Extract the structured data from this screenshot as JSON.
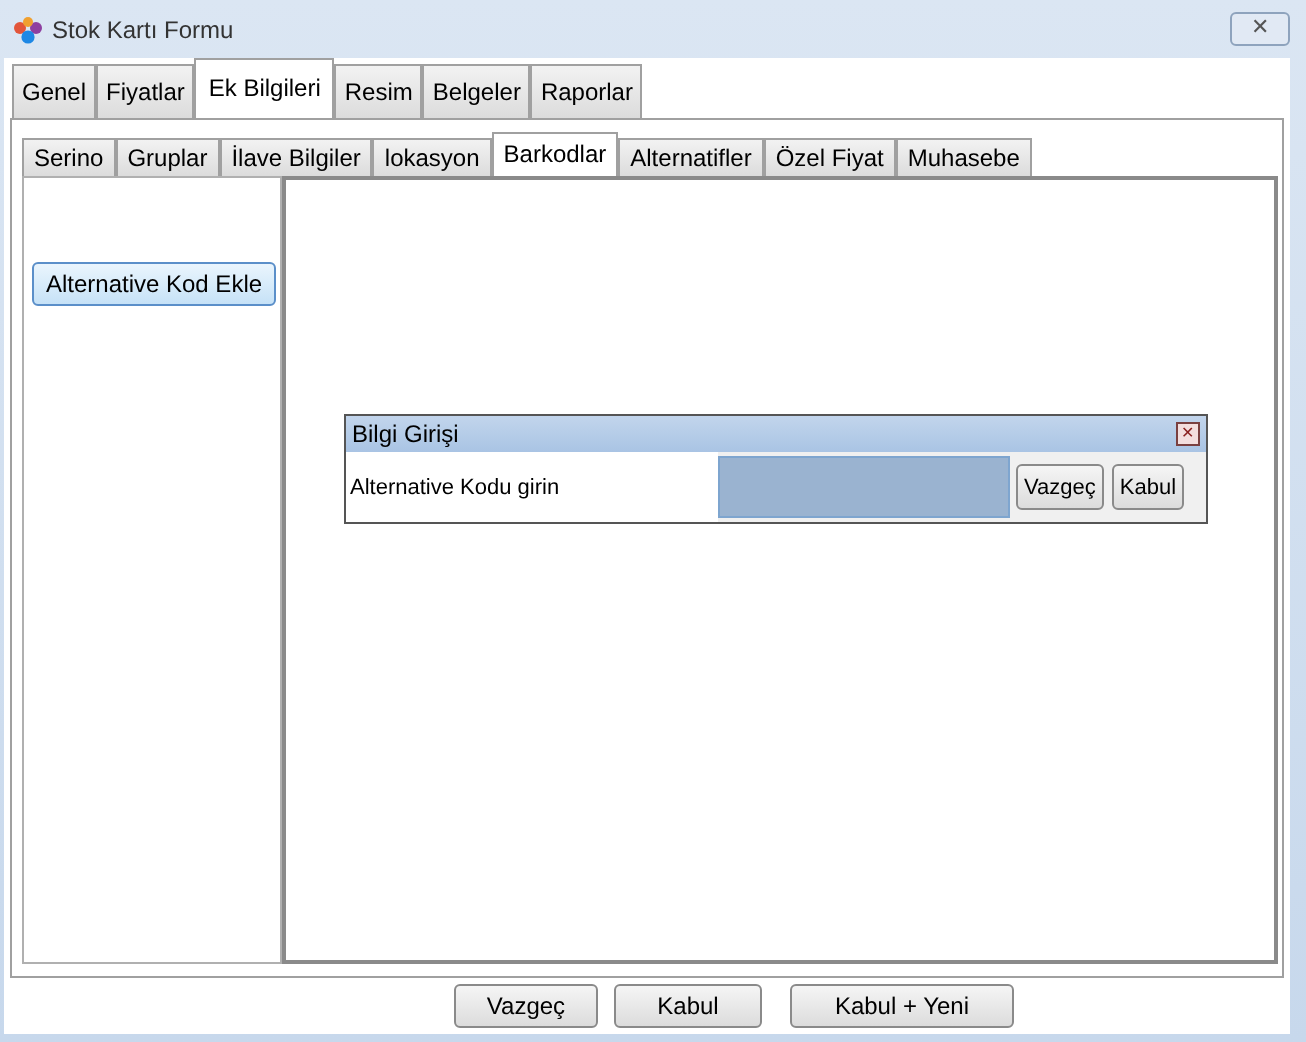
{
  "window": {
    "title": "Stok Kartı Formu",
    "close": "✕"
  },
  "tabs": [
    {
      "label": "Genel",
      "selected": false
    },
    {
      "label": "Fiyatlar",
      "selected": false
    },
    {
      "label": "Ek Bilgileri",
      "selected": true
    },
    {
      "label": "Resim",
      "selected": false
    },
    {
      "label": "Belgeler",
      "selected": false
    },
    {
      "label": "Raporlar",
      "selected": false
    }
  ],
  "sub_tabs": [
    {
      "label": "Serino",
      "selected": false
    },
    {
      "label": "Gruplar",
      "selected": false
    },
    {
      "label": "İlave Bilgiler",
      "selected": false
    },
    {
      "label": "lokasyon",
      "selected": false
    },
    {
      "label": "Barkodlar",
      "selected": true
    },
    {
      "label": "Alternatifler",
      "selected": false
    },
    {
      "label": "Özel Fiyat",
      "selected": false
    },
    {
      "label": "Muhasebe",
      "selected": false
    }
  ],
  "side_button": "Alternative Kod Ekle",
  "dialog": {
    "title": "Bilgi Girişi",
    "close": "✕",
    "label": "Alternative Kodu girin",
    "buttons": [
      "Vazgeç",
      "Kabul"
    ]
  },
  "buttons": [
    "Vazgeç",
    "Kabul",
    "Kabul + Yeni"
  ]
}
